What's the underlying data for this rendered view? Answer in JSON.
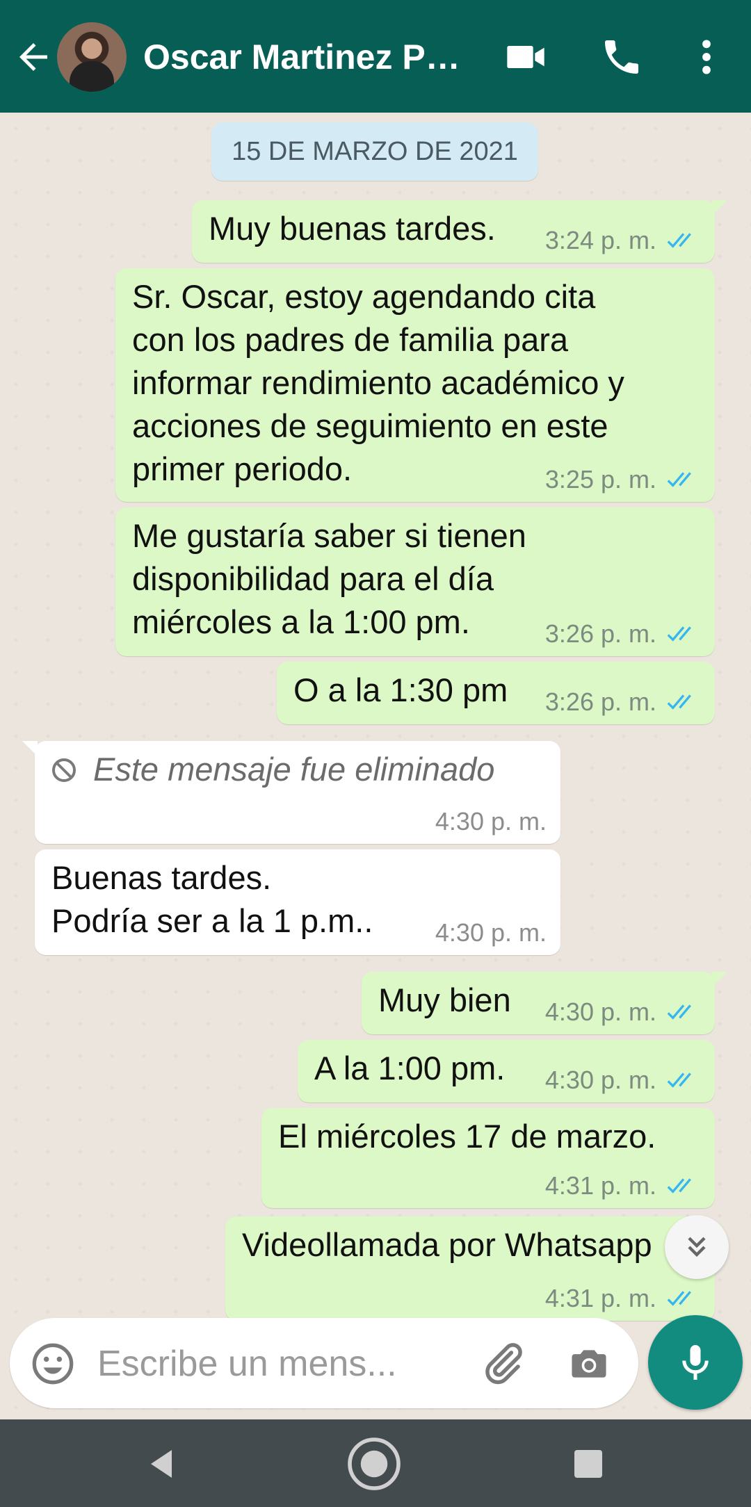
{
  "header": {
    "contact_name": "Oscar Martinez Pa..."
  },
  "chat": {
    "date_label": "15 DE MARZO DE 2021",
    "messages": [
      {
        "dir": "out",
        "text": "Muy buenas tardes.",
        "time": "3:24 p. m.",
        "status": "read"
      },
      {
        "dir": "out",
        "text": "Sr. Oscar, estoy agendando cita\ncon los padres de familia para\ninformar rendimiento académico y\nacciones de seguimiento en este\nprimer periodo.",
        "time": "3:25 p. m.",
        "status": "read"
      },
      {
        "dir": "out",
        "text": "Me gustaría saber si tienen\ndisponibilidad para el día\nmiércoles a la 1:00 pm.",
        "time": "3:26 p. m.",
        "status": "read"
      },
      {
        "dir": "out",
        "text": "O a la 1:30 pm",
        "time": "3:26 p. m.",
        "status": "read"
      },
      {
        "dir": "in",
        "text": "Este mensaje fue eliminado",
        "time": "4:30 p. m.",
        "deleted": true
      },
      {
        "dir": "in",
        "text": "Buenas tardes.\nPodría ser a la 1 p.m..",
        "time": "4:30 p. m."
      },
      {
        "dir": "out",
        "text": "Muy bien",
        "time": "4:30 p. m.",
        "status": "read"
      },
      {
        "dir": "out",
        "text": "A la 1:00 pm.",
        "time": "4:30 p. m.",
        "status": "read"
      },
      {
        "dir": "out",
        "text": "El miércoles 17 de marzo.",
        "time": "4:31 p. m.",
        "status": "read"
      },
      {
        "dir": "out",
        "text": "Videollamada por Whatsapp",
        "time": "4:31 p. m.",
        "status": "read"
      }
    ]
  },
  "composer": {
    "placeholder": "Escribe un mens..."
  },
  "colors": {
    "header": "#075e54",
    "outgoing_bubble": "#dcf8c6",
    "incoming_bubble": "#ffffff",
    "read_ticks": "#34b7f1",
    "mic_button": "#128c7e"
  },
  "icons": {
    "header": [
      "back-arrow-icon",
      "video-call-icon",
      "phone-icon",
      "more-vert-icon"
    ],
    "composer": [
      "emoji-icon",
      "attach-icon",
      "camera-icon",
      "mic-icon"
    ],
    "navigation": [
      "nav-back-icon",
      "nav-home-icon",
      "nav-recents-icon"
    ]
  }
}
